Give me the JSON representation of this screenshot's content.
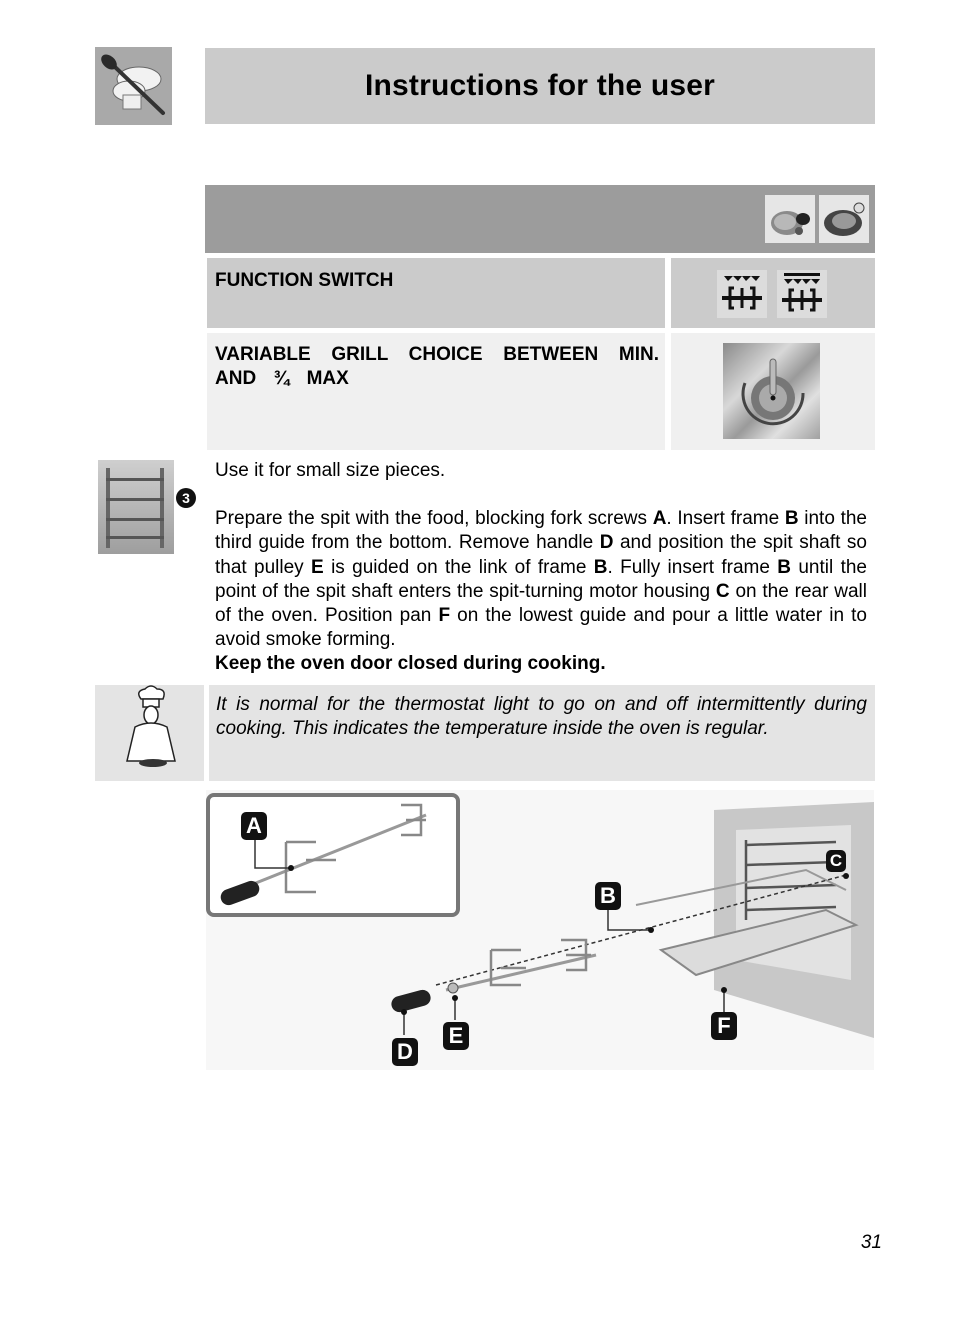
{
  "header": {
    "title": "Instructions for the user",
    "logo_icon": "spoon-and-chef-hat-icon"
  },
  "section": {
    "icons": [
      "meat-roast-icon",
      "roast-chicken-icon"
    ]
  },
  "table": {
    "rows": [
      {
        "label": "FUNCTION SWITCH",
        "icons": [
          "grill-rotisserie-icon",
          "full-grill-rotisserie-icon"
        ]
      },
      {
        "label": "VARIABLE GRILL CHOICE BETWEEN MIN. AND ¾ MAX",
        "icons": [
          "thermostat-knob-icon"
        ]
      }
    ]
  },
  "body": {
    "rack_icon": "oven-rack-guide-icon",
    "rack_badge": "3",
    "intro": "Use it for small size pieces.",
    "procedure": [
      {
        "t": "Prepare the spit with the food, blocking fork screws ",
        "b": false
      },
      {
        "t": "A",
        "b": true
      },
      {
        "t": ". Insert frame ",
        "b": false
      },
      {
        "t": "B",
        "b": true
      },
      {
        "t": " into the third guide from the bottom. Remove handle ",
        "b": false
      },
      {
        "t": "D",
        "b": true
      },
      {
        "t": " and position the spit shaft so that pulley ",
        "b": false
      },
      {
        "t": "E",
        "b": true
      },
      {
        "t": " is guided on the link of  frame ",
        "b": false
      },
      {
        "t": "B",
        "b": true
      },
      {
        "t": ". Fully insert frame ",
        "b": false
      },
      {
        "t": "B",
        "b": true
      },
      {
        "t": " until the point of the spit shaft enters the spit-turning motor housing ",
        "b": false
      },
      {
        "t": "C",
        "b": true
      },
      {
        "t": " on the rear wall of the oven. Position pan ",
        "b": false
      },
      {
        "t": "F",
        "b": true
      },
      {
        "t": " on the lowest guide and pour a little water in to avoid smoke forming.",
        "b": false
      }
    ],
    "warning": "Keep the oven door closed during cooking."
  },
  "note": {
    "icon": "chef-icon",
    "text": "It is normal for the thermostat light to go on and off intermittently during cooking. This indicates the temperature inside the oven is regular."
  },
  "illustration": {
    "labels": [
      "A",
      "B",
      "C",
      "D",
      "E",
      "F"
    ]
  },
  "page_number": "31"
}
